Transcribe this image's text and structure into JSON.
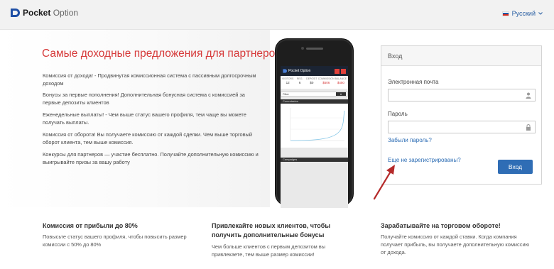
{
  "header": {
    "logo_bold": "Pocket",
    "logo_light": " Option",
    "language": "Русский",
    "flag_colors": [
      "#ffffff",
      "#1c57a5",
      "#d52b1e"
    ]
  },
  "hero": {
    "title": "Самые доходные предложения для партнеров",
    "features": [
      "Комиссия от дохода! - Продвинутая комиссионная система с пассивным долгосрочным доходом",
      "Бонусы за первые пополнения! Дополнительная бонусная система с комиссией за первые депозиты клиентов",
      "Еженедельные выплаты! - Чем выше статус вашего профиля, тем чаще вы можете получать выплаты.",
      "Комиссия от оборота! Вы получаете комиссию от каждой сделки. Чем выше торговый оборот клиента, тем выше комиссия.",
      "Конкурсы для партнеров — участие бесплатно. Получайте дополнительную комиссию и выигрывайте призы за вашу работу"
    ]
  },
  "phone": {
    "app_name": "Pocket Option",
    "stats": [
      {
        "label": "VISITORS",
        "value": "12",
        "color": "#333333"
      },
      {
        "label": "REG.",
        "value": "6",
        "color": "#333333"
      },
      {
        "label": "DEPOSIT",
        "value": "$0",
        "color": "#333333"
      },
      {
        "label": "COMMISSION",
        "value": "$506",
        "color": "#d63a3a"
      },
      {
        "label": "BALANCE",
        "value": "$450",
        "color": "#d63a3a"
      }
    ],
    "filter_label": "Filter",
    "filter_value": "",
    "section_commission": "Commission",
    "section_campaigns": "Campaigns"
  },
  "login": {
    "title": "Вход",
    "email_label": "Электронная почта",
    "email_value": "",
    "password_label": "Пароль",
    "password_value": "",
    "forgot_link": "Забыли пароль?",
    "register_link": "Еще не зарегистрированы?",
    "submit_label": "Вход"
  },
  "columns": [
    {
      "title": "Комиссия от прибыли до 80%",
      "text": "Повысьте статус вашего профиля, чтобы повысить размер комиссии с 50% до 80%"
    },
    {
      "title": "Привлекайте новых клиентов, чтобы получить дополнительные бонусы",
      "text": "Чем больше клиентов с первым депозитом вы привлекаете, тем выше размер комиссии!"
    },
    {
      "title": "Зарабатывайте на торговом обороте!",
      "text": "Получайте комиссию от каждой ставки. Когда компания получает прибыль, вы получаете дополнительную комиссию от дохода."
    }
  ],
  "colors": {
    "accent_red": "#d63a3a",
    "link_blue": "#2a6bb3",
    "button_blue": "#2f6db5",
    "arrow_red": "#b52a2a"
  }
}
